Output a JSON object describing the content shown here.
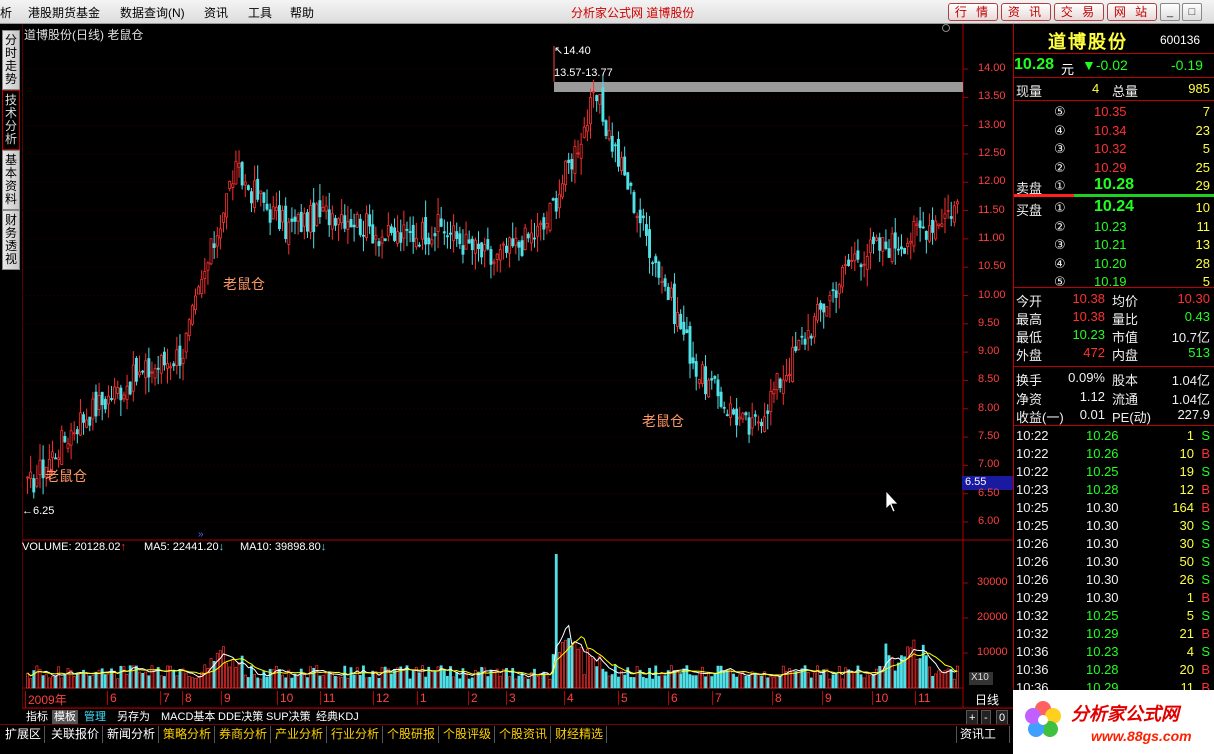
{
  "menu": {
    "items": [
      "析",
      "港股期货基金",
      "数据查询(N)",
      "资讯",
      "工具",
      "帮助"
    ],
    "brand": "分析家公式网 道博股份",
    "nav_buttons": [
      "行 情",
      "资 讯",
      "交 易",
      "网 站"
    ],
    "window_buttons": [
      "_",
      "□",
      "×"
    ]
  },
  "side_tabs": [
    "分时走势",
    "技术分析",
    "基本资料",
    "财务透视"
  ],
  "chart": {
    "title": "道博股份(日线) 老鼠仓",
    "price_axis": [
      "14.00",
      "13.50",
      "13.00",
      "12.50",
      "12.00",
      "11.50",
      "11.00",
      "10.50",
      "10.00",
      "9.50",
      "9.00",
      "8.50",
      "8.00",
      "7.50",
      "7.00",
      "6.50",
      "6.00"
    ],
    "max_marker": "14.40",
    "min_marker": "6.25",
    "range_label": "13.57-13.77",
    "current_price_tag": "6.55",
    "annotations": [
      "老鼠仓",
      "老鼠仓",
      "老鼠仓"
    ],
    "volume_header": {
      "volume": "VOLUME: 20128.02",
      "ma5": "MA5: 22441.20",
      "ma10": "MA10: 39898.80"
    },
    "volume_axis": [
      "30000",
      "20000",
      "10000"
    ],
    "volume_scale": "X10",
    "month_axis": [
      "2009年",
      "6",
      "7",
      "8",
      "9",
      "10",
      "11",
      "12",
      "1",
      "2",
      "3",
      "4",
      "5",
      "6",
      "7",
      "8",
      "9",
      "10",
      "11"
    ],
    "period": "日线",
    "zoom_buttons": [
      "+",
      "-",
      "0"
    ],
    "colors": {
      "up": "#ff3030",
      "down": "#50e0e8",
      "ma5": "#ffffff",
      "ma10": "#ffff00",
      "grid": "#8b0000"
    }
  },
  "chart_data": {
    "type": "line",
    "title": "道博股份(日线) 老鼠仓",
    "xlabel": "",
    "ylabel": "",
    "ylim": [
      6.0,
      14.4
    ],
    "series": [
      {
        "x": [
          "2009年",
          "6",
          "7",
          "8",
          "9",
          "10",
          "11",
          "12",
          "1",
          "2",
          "3",
          "4",
          "5",
          "6",
          "7",
          "8",
          "9",
          "10",
          "11"
        ],
        "values": [
          6.6,
          7.8,
          8.5,
          9.0,
          12.2,
          11.2,
          11.5,
          11.0,
          11.2,
          10.6,
          11.2,
          13.5,
          11.0,
          8.6,
          7.6,
          9.2,
          10.7,
          11.0,
          11.6
        ]
      }
    ]
  },
  "quote": {
    "name": "道博股份",
    "code": "600136",
    "price": "10.28",
    "price_unit": "元",
    "change": "▼-0.02",
    "change_pct": "-0.19",
    "volume_label": "现量",
    "volume_value": "4",
    "total_label": "总量",
    "total_value": "985",
    "sell": [
      {
        "level": "⑤",
        "price": "10.35",
        "vol": "7"
      },
      {
        "level": "④",
        "price": "10.34",
        "vol": "23"
      },
      {
        "level": "③",
        "price": "10.32",
        "vol": "5"
      },
      {
        "level": "②",
        "price": "10.29",
        "vol": "25"
      },
      {
        "label": "卖盘",
        "level": "①",
        "price": "10.28",
        "vol": "29"
      }
    ],
    "buy": [
      {
        "label": "买盘",
        "level": "①",
        "price": "10.24",
        "vol": "10"
      },
      {
        "level": "②",
        "price": "10.23",
        "vol": "11"
      },
      {
        "level": "③",
        "price": "10.21",
        "vol": "13"
      },
      {
        "level": "④",
        "price": "10.20",
        "vol": "28"
      },
      {
        "level": "⑤",
        "price": "10.19",
        "vol": "5"
      }
    ],
    "stats": [
      {
        "l1": "今开",
        "v1": "10.38",
        "l2": "均价",
        "v2": "10.30"
      },
      {
        "l1": "最高",
        "v1": "10.38",
        "l2": "量比",
        "v2": "0.43"
      },
      {
        "l1": "最低",
        "v1": "10.23",
        "l2": "市值",
        "v2": "10.7亿"
      },
      {
        "l1": "外盘",
        "v1": "472",
        "l2": "内盘",
        "v2": "513"
      }
    ],
    "fin": [
      {
        "l1": "换手",
        "v1": "0.09%",
        "l2": "股本",
        "v2": "1.04亿"
      },
      {
        "l1": "净资",
        "v1": "1.12",
        "l2": "流通",
        "v2": "1.04亿"
      },
      {
        "l1": "收益(一)",
        "v1": "0.01",
        "l2": "PE(动)",
        "v2": "227.9"
      }
    ],
    "ticks": [
      {
        "t": "10:22",
        "p": "10.26",
        "v": "1",
        "s": "S"
      },
      {
        "t": "10:22",
        "p": "10.26",
        "v": "10",
        "s": "B"
      },
      {
        "t": "10:22",
        "p": "10.25",
        "v": "19",
        "s": "S"
      },
      {
        "t": "10:23",
        "p": "10.28",
        "v": "12",
        "s": "B"
      },
      {
        "t": "10:25",
        "p": "10.30",
        "v": "164",
        "s": "B"
      },
      {
        "t": "10:25",
        "p": "10.30",
        "v": "30",
        "s": "S"
      },
      {
        "t": "10:26",
        "p": "10.30",
        "v": "30",
        "s": "S"
      },
      {
        "t": "10:26",
        "p": "10.30",
        "v": "50",
        "s": "S"
      },
      {
        "t": "10:26",
        "p": "10.30",
        "v": "26",
        "s": "S"
      },
      {
        "t": "10:29",
        "p": "10.30",
        "v": "1",
        "s": "B"
      },
      {
        "t": "10:32",
        "p": "10.25",
        "v": "5",
        "s": "S"
      },
      {
        "t": "10:32",
        "p": "10.29",
        "v": "21",
        "s": "B"
      },
      {
        "t": "10:36",
        "p": "10.23",
        "v": "4",
        "s": "S"
      },
      {
        "t": "10:36",
        "p": "10.28",
        "v": "20",
        "s": "B"
      },
      {
        "t": "10:36",
        "p": "10.29",
        "v": "11",
        "s": "B"
      }
    ]
  },
  "toolbar1": [
    "指标",
    "模板",
    "管理",
    "另存为",
    "MACD基本",
    "DDE决策",
    "SUP决策",
    "经典KDJ"
  ],
  "toolbar2": [
    "扩展区",
    "关联报价",
    "新闻分析",
    "策略分析",
    "券商分析",
    "产业分析",
    "行业分析",
    "个股研报",
    "个股评级",
    "个股资讯",
    "财经精选"
  ],
  "toolbar2_right": "资讯工场",
  "logo": {
    "title": "分析家公式网",
    "url": "www.88gs.com"
  }
}
